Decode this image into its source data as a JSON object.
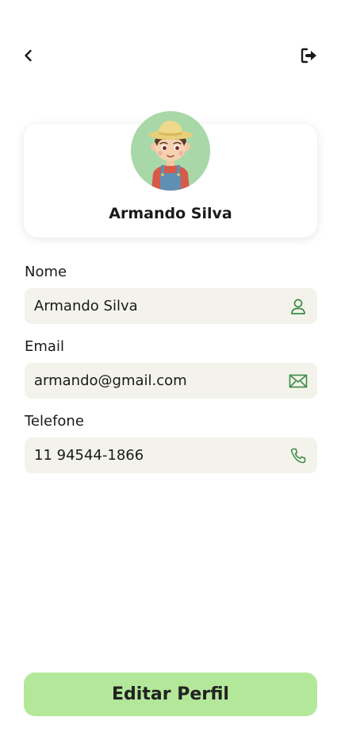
{
  "header": {
    "back_icon": "chevron-left-icon",
    "logout_icon": "logout-icon"
  },
  "profile": {
    "name": "Armando Silva",
    "avatar": "farmer-avatar-illustration"
  },
  "fields": {
    "name": {
      "label": "Nome",
      "value": "Armando Silva",
      "icon": "user-icon"
    },
    "email": {
      "label": "Email",
      "value": "armando@gmail.com",
      "icon": "envelope-icon"
    },
    "phone": {
      "label": "Telefone",
      "value": "11 94544-1866",
      "icon": "phone-icon"
    }
  },
  "actions": {
    "edit_label": "Editar Perfil"
  },
  "colors": {
    "accent": "#b3e89a",
    "icon_green": "#3a8a46",
    "field_bg": "#f3f3eb",
    "avatar_bg": "#a8d8a8"
  }
}
